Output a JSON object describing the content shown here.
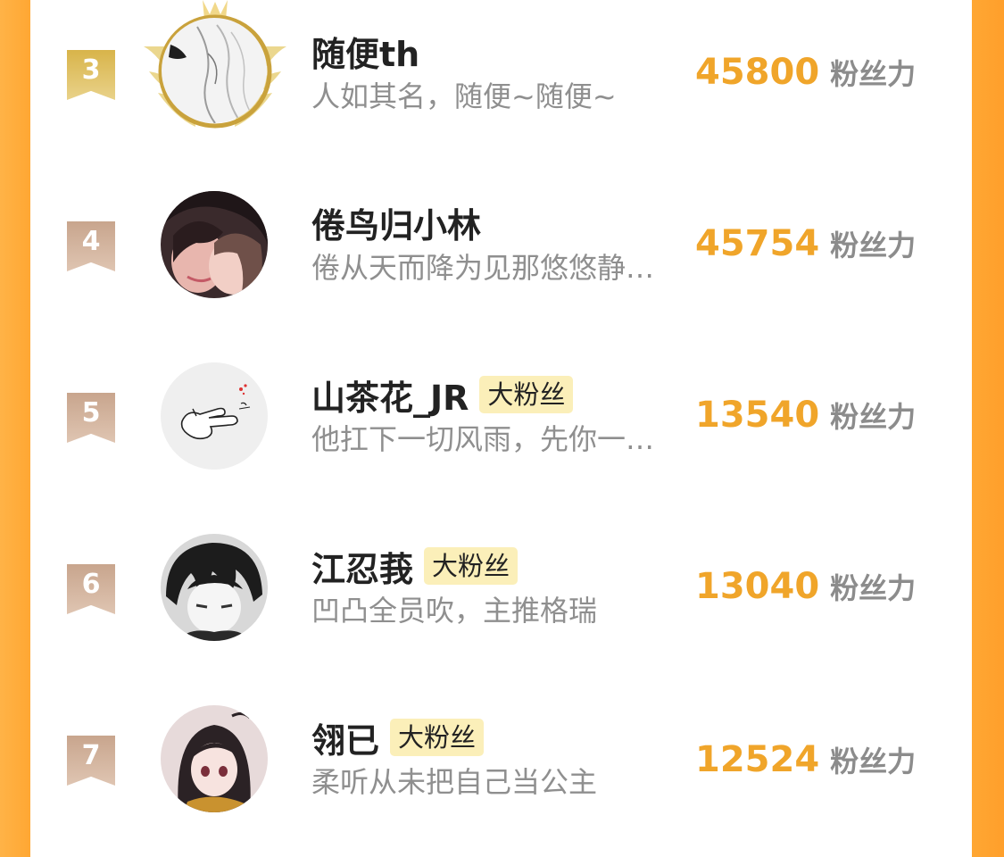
{
  "fans_label": "粉丝力",
  "rows": [
    {
      "rank": "3",
      "name": "随便th",
      "tag": "",
      "bio": "人如其名，随便~随便~",
      "fans": "45800",
      "avatar_icon": "sketch-avatar-icon"
    },
    {
      "rank": "4",
      "name": "倦鸟归小林",
      "tag": "",
      "bio": "倦从天而降为见那悠悠静…",
      "fans": "45754",
      "avatar_icon": "anime-couple-avatar-icon"
    },
    {
      "rank": "5",
      "name": "山茶花_JR",
      "tag": "大粉丝",
      "bio": "他扛下一切风雨，先你一…",
      "fans": "13540",
      "avatar_icon": "hand-sketch-avatar-icon"
    },
    {
      "rank": "6",
      "name": "江忍莪",
      "tag": "大粉丝",
      "bio": "凹凸全员吹，主推格瑞",
      "fans": "13040",
      "avatar_icon": "anime-boy-avatar-icon"
    },
    {
      "rank": "7",
      "name": "翎已",
      "tag": "大粉丝",
      "bio": "柔听从未把自己当公主",
      "fans": "12524",
      "avatar_icon": "anime-girl-avatar-icon"
    }
  ],
  "colors": {
    "accent_orange": "#ffa733",
    "fans_number": "#f0a52a",
    "tag_bg": "#fbefb9",
    "rank_gold": "#d8b44a",
    "rank_tan": "#c8a58d"
  }
}
